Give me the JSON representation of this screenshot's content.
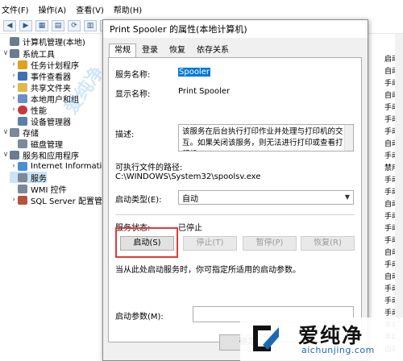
{
  "menu": {
    "items": [
      "文件(F)",
      "操作(A)",
      "查看(V)",
      "帮助(H)"
    ]
  },
  "toolbar": {
    "icons": [
      "back-icon",
      "forward-icon",
      "up-icon",
      "properties-icon",
      "refresh-icon",
      "export-icon",
      "help-icon",
      "view-icon",
      "play-icon",
      "stop-icon",
      "pause-icon",
      "restart-icon"
    ]
  },
  "tree": {
    "items": [
      {
        "label": "计算机管理(本地)",
        "twisty": "",
        "color": "#6a7c8f"
      },
      {
        "label": "系统工具",
        "twisty": "∨",
        "color": "#6a7c8f"
      },
      {
        "label": "任务计划程序",
        "twisty": "›",
        "color": "#e0a020"
      },
      {
        "label": "事件查看器",
        "twisty": "›",
        "color": "#3f6fb5"
      },
      {
        "label": "共享文件夹",
        "twisty": "›",
        "color": "#e3b84a"
      },
      {
        "label": "本地用户和组",
        "twisty": "›",
        "color": "#6b8fc2"
      },
      {
        "label": "性能",
        "twisty": "›",
        "color": "#c23b3b"
      },
      {
        "label": "设备管理器",
        "twisty": "",
        "color": "#5b7fa8"
      },
      {
        "label": "存储",
        "twisty": "∨",
        "color": "#7a8a99"
      },
      {
        "label": "磁盘管理",
        "twisty": "",
        "color": "#7a8a99"
      },
      {
        "label": "服务和应用程序",
        "twisty": "∨",
        "color": "#6a7c8f"
      },
      {
        "label": "Internet Information S",
        "twisty": "›",
        "color": "#4a8fd0"
      },
      {
        "label": "服务",
        "twisty": "",
        "color": "#7c8896"
      },
      {
        "label": "WMI 控件",
        "twisty": "",
        "color": "#7c8896"
      },
      {
        "label": "SQL Server 配置管理器",
        "twisty": "›",
        "color": "#b5543a"
      }
    ]
  },
  "right_column": {
    "items": [
      "启动类",
      "自动",
      "手动(",
      "自动",
      "手动(",
      "手动(",
      "手动(",
      "自动",
      "手动(",
      "禁用",
      "手动",
      "手动(",
      "自动",
      "手动",
      "手动(",
      "手动(",
      "自动",
      "手动(",
      "自动",
      "手动(",
      "手动",
      "手动",
      "手动(",
      "手动",
      "自动"
    ]
  },
  "dialog": {
    "title": "Print Spooler 的属性(本地计算机)",
    "tabs": [
      "常规",
      "登录",
      "恢复",
      "依存关系"
    ],
    "service_name_label": "服务名称:",
    "service_name_value": "Spooler",
    "display_name_label": "显示名称:",
    "display_name_value": "Print Spooler",
    "description_label": "描述:",
    "description_value": "该服务在后台执行打印作业并处理与打印机的交互。如果关闭该服务，则无法进行打印或查看打印机。",
    "exe_path_label": "可执行文件的路径:",
    "exe_path_value": "C:\\WINDOWS\\System32\\spoolsv.exe",
    "startup_type_label": "启动类型(E):",
    "startup_type_value": "自动",
    "status_label": "服务状态:",
    "status_value": "已停止",
    "start_button": "启动(S)",
    "stop_button": "停止(T)",
    "pause_button": "暂停(P)",
    "resume_button": "恢复(R)",
    "hint": "当从此处启动服务时，你可指定所适用的启动参数。",
    "start_params_label": "启动参数(M):",
    "start_params_value": "",
    "ok_button": "确定",
    "highlight_color": "#e03a3a"
  },
  "watermark": {
    "left_text": "爱纯净",
    "logo_name": "爱纯净",
    "logo_url": "aichunjing.com"
  }
}
